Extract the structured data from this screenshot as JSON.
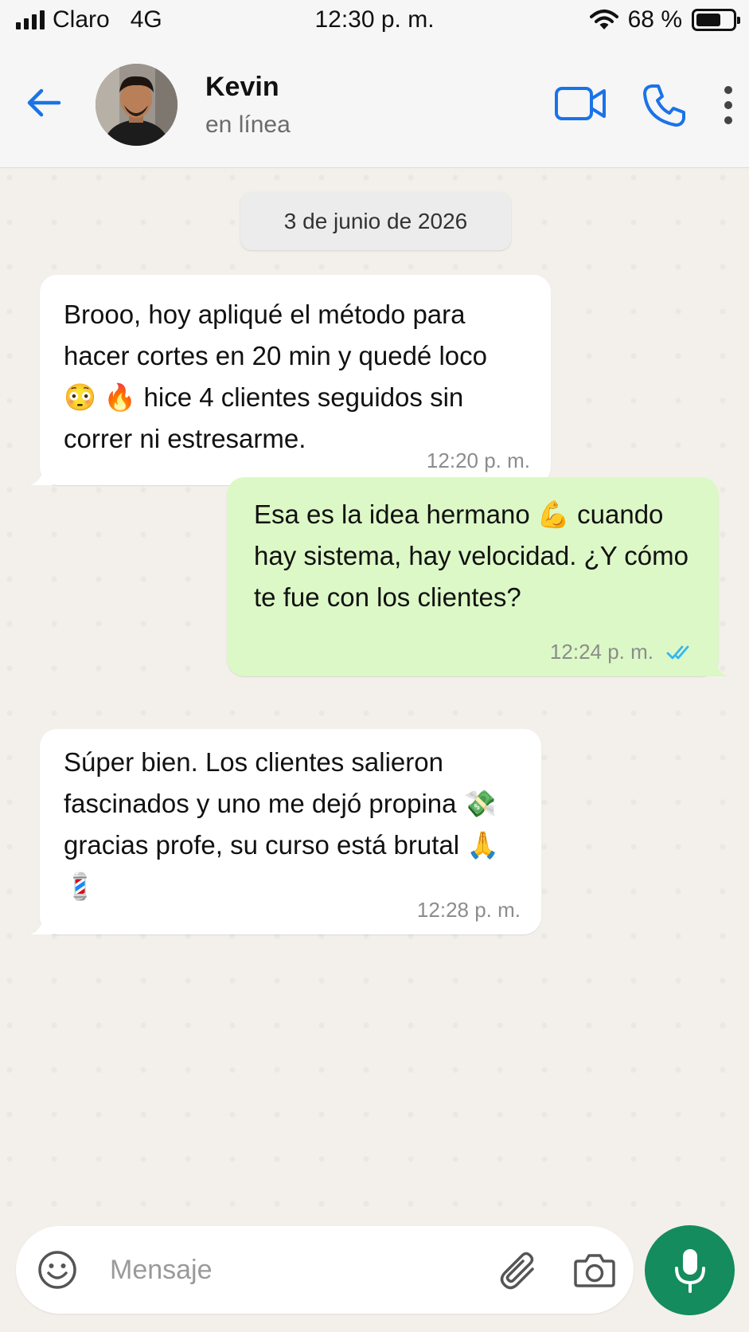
{
  "status_bar": {
    "carrier": "Claro",
    "network": "4G",
    "time": "12:30 p. m.",
    "battery": "68 %",
    "battery_level": 0.68
  },
  "header": {
    "contact_name": "Kevin",
    "contact_status": "en línea",
    "icons": [
      "arrow-left-icon",
      "video-camera-icon",
      "phone-icon",
      "more-vertical-icon"
    ]
  },
  "chat": {
    "date_label": "3 de junio de 2026",
    "messages": [
      {
        "direction": "in",
        "text": "Brooo, hoy apliqué el método para hacer cortes en 20 min y quedé loco 😳 🔥 hice 4 clientes seguidos sin correr ni estresarme.",
        "time": "12:20 p. m."
      },
      {
        "direction": "out",
        "text": "Esa es la idea hermano 💪 cuando hay sistema, hay velocidad. ¿Y cómo te fue con los clientes?",
        "time": "12:24 p. m.",
        "status": "read"
      },
      {
        "direction": "in",
        "text": "Súper bien. Los clientes salieron fascinados y uno me dejó propina 💸 gracias profe, su curso está brutal 🙏 💈",
        "time": "12:28 p. m."
      }
    ]
  },
  "composer": {
    "placeholder": "Mensaje",
    "icons": [
      "emoji-icon",
      "paperclip-icon",
      "camera-icon",
      "microphone-icon"
    ]
  },
  "colors": {
    "accent_blue": "#1a73e8",
    "outgoing_bubble": "#dcf8c6",
    "mic_button": "#148c5d",
    "read_ticks": "#34b7f1"
  }
}
